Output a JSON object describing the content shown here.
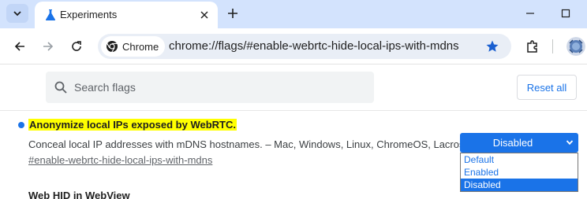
{
  "tab": {
    "title": "Experiments"
  },
  "omnibox": {
    "chip_label": "Chrome",
    "url": "chrome://flags/#enable-webrtc-hide-local-ips-with-mdns"
  },
  "search": {
    "placeholder": "Search flags",
    "value": ""
  },
  "reset_label": "Reset all",
  "experiment": {
    "title": "Anonymize local IPs exposed by WebRTC.",
    "description": "Conceal local IP addresses with mDNS hostnames. – Mac, Windows, Linux, ChromeOS, Lacros",
    "link": "#enable-webrtc-hide-local-ips-with-mdns",
    "selected": "Disabled",
    "options": [
      "Default",
      "Enabled",
      "Disabled"
    ]
  },
  "next_experiment": {
    "title": "Web HID in WebView"
  },
  "colors": {
    "accent": "#1a73e8",
    "highlight": "#ffff00",
    "tabstrip": "#d3e3fd"
  },
  "icons": [
    "chevron-down-icon",
    "flask-icon",
    "close-icon",
    "plus-icon",
    "minimize-icon",
    "maximize-icon",
    "back-icon",
    "forward-icon",
    "reload-icon",
    "chrome-logo-icon",
    "star-icon",
    "extensions-icon",
    "avatar",
    "search-icon"
  ]
}
